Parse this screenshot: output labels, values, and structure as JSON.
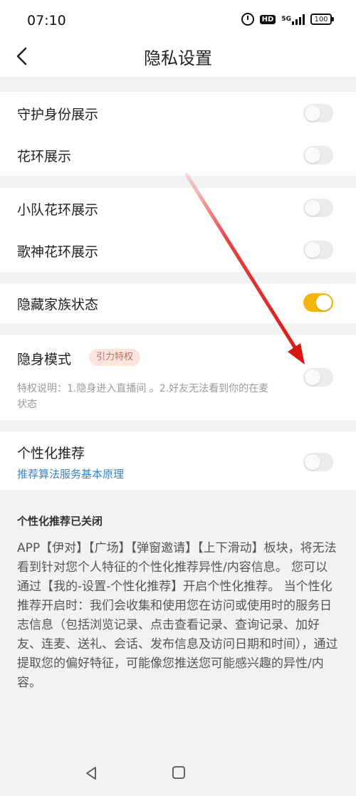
{
  "status_bar": {
    "time": "07:10",
    "hd_label": "HD",
    "network_label": "5G",
    "battery": "100"
  },
  "header": {
    "title": "隐私设置",
    "back_icon": "chevron-left-icon"
  },
  "settings": {
    "guard_identity": {
      "label": "守护身份展示",
      "enabled": false
    },
    "wreath_display": {
      "label": "花环展示",
      "enabled": false
    },
    "team_wreath": {
      "label": "小队花环展示",
      "enabled": false
    },
    "singer_wreath": {
      "label": "歌神花环展示",
      "enabled": false
    },
    "hide_family": {
      "label": "隐藏家族状态",
      "enabled": true
    },
    "stealth_mode": {
      "label": "隐身模式",
      "badge": "引力特权",
      "description": "特权说明：1.隐身进入直播间 。2.好友无法看到你的在麦状态",
      "enabled": false
    },
    "personalized": {
      "label": "个性化推荐",
      "link": "推荐算法服务基本原理",
      "enabled": false
    }
  },
  "info": {
    "title": "个性化推荐已关闭",
    "body": "APP【伊对】【广场】【弹窗邀请】【上下滑动】板块，将无法看到针对您个人特征的个性化推荐异性/内容信息。 您可以通过【我的-设置-个性化推荐】开启个性化推荐。 当个性化推荐开启时：我们会收集和使用您在访问或使用时的服务日志信息（包括浏览记录、点击查看记录、查询记录、加好友、连麦、送礼、会话、发布信息及访问日期和时间），通过提取您的偏好特征，可能像您推送您可能感兴趣的异性/内容。"
  },
  "colors": {
    "toggle_on": "#f5b50a",
    "toggle_off": "#ebebeb",
    "badge_bg": "#fbe5df",
    "badge_text": "#c46c5a",
    "link": "#3b82c4",
    "annotation_arrow": "#e02020"
  },
  "bottom_nav": {
    "back_icon": "triangle-back-icon",
    "home_icon": "square-home-icon"
  }
}
